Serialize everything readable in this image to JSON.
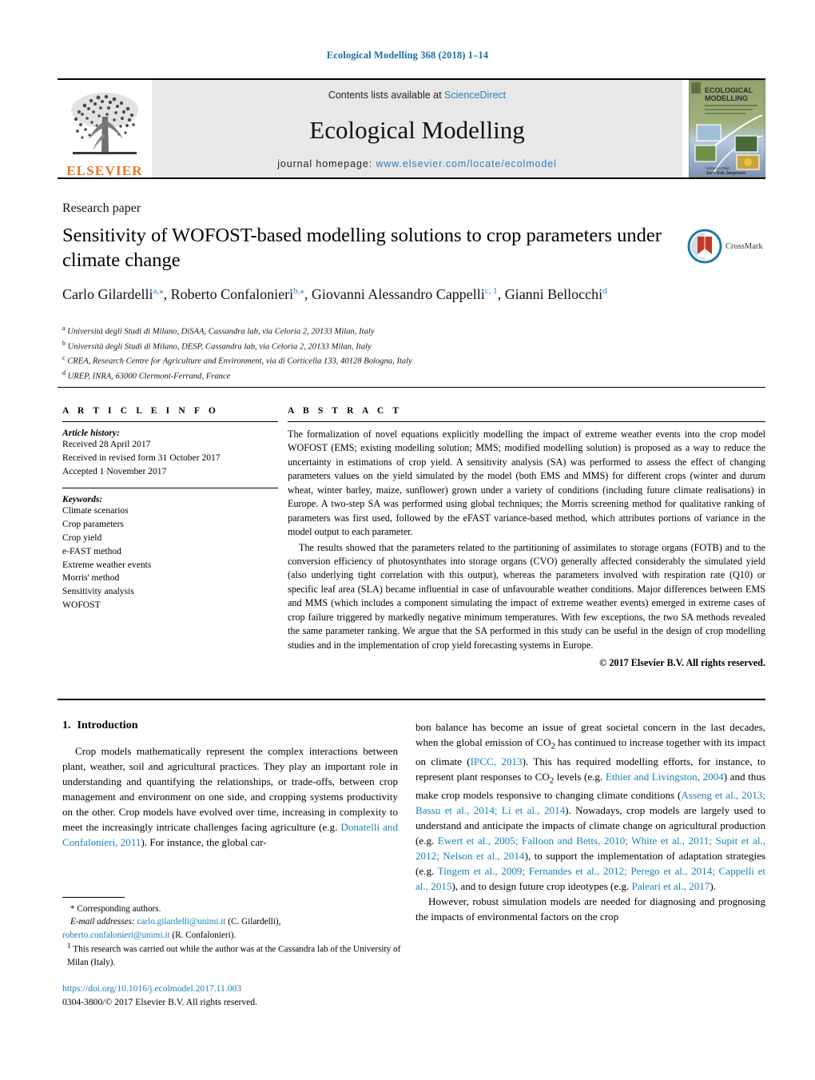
{
  "running_head": "Ecological Modelling 368 (2018) 1–14",
  "masthead": {
    "publisher_name": "ELSEVIER",
    "contents_prefix": "Contents lists available at ",
    "contents_link": "ScienceDirect",
    "journal_title": "Ecological Modelling",
    "homepage_prefix": "journal homepage: ",
    "homepage_url": "www.elsevier.com/locate/ecolmodel",
    "cover_title_line1": "ECOLOGICAL",
    "cover_title_line2": "MODELLING"
  },
  "article": {
    "doc_type": "Research paper",
    "title": "Sensitivity of WOFOST-based modelling solutions to crop parameters under climate change",
    "crossmark_label": "CrossMark",
    "authors_html": "Carlo Gilardelli<sup>a,&#8270;</sup>, Roberto Confalonieri<sup>b,&#8270;</sup>, Giovanni Alessandro Cappelli<sup>c, 1</sup>, Gianni Bellocchi<sup>d</sup>",
    "affiliations": [
      {
        "marker": "a",
        "text": "Università degli Studi di Milano, DiSAA, Cassandra lab, via Celoria 2, 20133 Milan, Italy"
      },
      {
        "marker": "b",
        "text": "Università degli Studi di Milano, DESP, Cassandra lab, via Celoria 2, 20133 Milan, Italy"
      },
      {
        "marker": "c",
        "text": "CREA, Research Centre for Agriculture and Environment, via di Corticella 133, 40128 Bologna, Italy"
      },
      {
        "marker": "d",
        "text": "UREP, INRA, 63000 Clermont-Ferrand, France"
      }
    ]
  },
  "article_info": {
    "heading": "A R T I C L E   I N F O",
    "history_label": "Article history:",
    "history": [
      "Received 28 April 2017",
      "Received in revised form 31 October 2017",
      "Accepted 1 November 2017"
    ],
    "keywords_label": "Keywords:",
    "keywords": [
      "Climate scenarios",
      "Crop parameters",
      "Crop yield",
      "e-FAST method",
      "Extreme weather events",
      "Morris' method",
      "Sensitivity analysis",
      "WOFOST"
    ]
  },
  "abstract": {
    "heading": "A B S T R A C T",
    "paragraph1": "The formalization of novel equations explicitly modelling the impact of extreme weather events into the crop model WOFOST (EMS; existing modelling solution; MMS; modified modelling solution) is proposed as a way to reduce the uncertainty in estimations of crop yield. A sensitivity analysis (SA) was performed to assess the effect of changing parameters values on the yield simulated by the model (both EMS and MMS) for different crops (winter and durum wheat, winter barley, maize, sunflower) grown under a variety of conditions (including future climate realisations) in Europe. A two-step SA was performed using global techniques; the Morris screening method for qualitative ranking of parameters was first used, followed by the eFAST variance-based method, which attributes portions of variance in the model output to each parameter.",
    "paragraph2": "The results showed that the parameters related to the partitioning of assimilates to storage organs (FOTB) and to the conversion efficiency of photosynthates into storage organs (CVO) generally affected considerably the simulated yield (also underlying tight correlation with this output), whereas the parameters involved with respiration rate (Q10) or specific leaf area (SLA) became influential in case of unfavourable weather conditions. Major differences between EMS and MMS (which includes a component simulating the impact of extreme weather events) emerged in extreme cases of crop failure triggered by markedly negative minimum temperatures. With few exceptions, the two SA methods revealed the same parameter ranking. We argue that the SA performed in this study can be useful in the design of crop modelling studies and in the implementation of crop yield forecasting systems in Europe.",
    "copyright": "© 2017 Elsevier B.V. All rights reserved."
  },
  "introduction": {
    "number": "1.",
    "heading": "Introduction",
    "left_paragraph_html": "Crop models mathematically represent the complex interactions between plant, weather, soil and agricultural practices. They play an important role in understanding and quantifying the relationships, or trade-offs, between crop management and environment on one side, and cropping systems productivity on the other. Crop models have evolved over time, increasing in complexity to meet the increasingly intricate challenges facing agriculture (e.g. <span class=\"ref\">Donatelli and Confalonieri, 2011</span>). For instance, the global car-",
    "right_paragraph1_html": "bon balance has become an issue of great societal concern in the last decades, when the global emission of CO<sub>2</sub> has continued to increase together with its impact on climate (<span class=\"ref\">IPCC, 2013</span>). This has required modelling efforts, for instance, to represent plant responses to CO<sub>2</sub> levels (e.g. <span class=\"ref\">Ethier and Livingston, 2004</span>) and thus make crop models responsive to changing climate conditions (<span class=\"ref\">Asseng et al., 2013; Bassu et al., 2014; Li et al., 2014</span>). Nowadays, crop models are largely used to understand and anticipate the impacts of climate change on agricultural production (e.g. <span class=\"ref\">Ewert et al., 2005; Falloon and Betts, 2010; White et al., 2011; Supit et al., 2012; Nelson et al., 2014</span>), to support the implementation of adaptation strategies (e.g. <span class=\"ref\">Tingem et al., 2009; Fernandes et al., 2012; Perego et al., 2014; Cappelli et al., 2015</span>), and to design future crop ideotypes (e.g. <span class=\"ref\">Paleari et al., 2017</span>).",
    "right_paragraph2_html": "However, robust simulation models are needed for diagnosing and prognosing the impacts of environmental factors on the crop"
  },
  "footnotes": {
    "corresponding": "* Corresponding authors.",
    "email_label": "E-mail addresses:",
    "email1": "carlo.gilardelli@unimi.it",
    "email1_owner": "(C. Gilardelli),",
    "email2": "roberto.confalonieri@unimi.it",
    "email2_owner": "(R. Confalonieri).",
    "note1_marker": "1",
    "note1_text": "This research was carried out while the author was at the Cassandra lab of the University of Milan (Italy)."
  },
  "doi_block": {
    "doi": "https://doi.org/10.1016/j.ecolmodel.2017.11.003",
    "issn_line": "0304-3800/© 2017 Elsevier B.V. All rights reserved."
  },
  "colors": {
    "link_blue": "#1b7fb8",
    "running_head_blue": "#1b6ea8",
    "elsevier_orange": "#e87722",
    "band_gray": "#e8e8e8"
  }
}
